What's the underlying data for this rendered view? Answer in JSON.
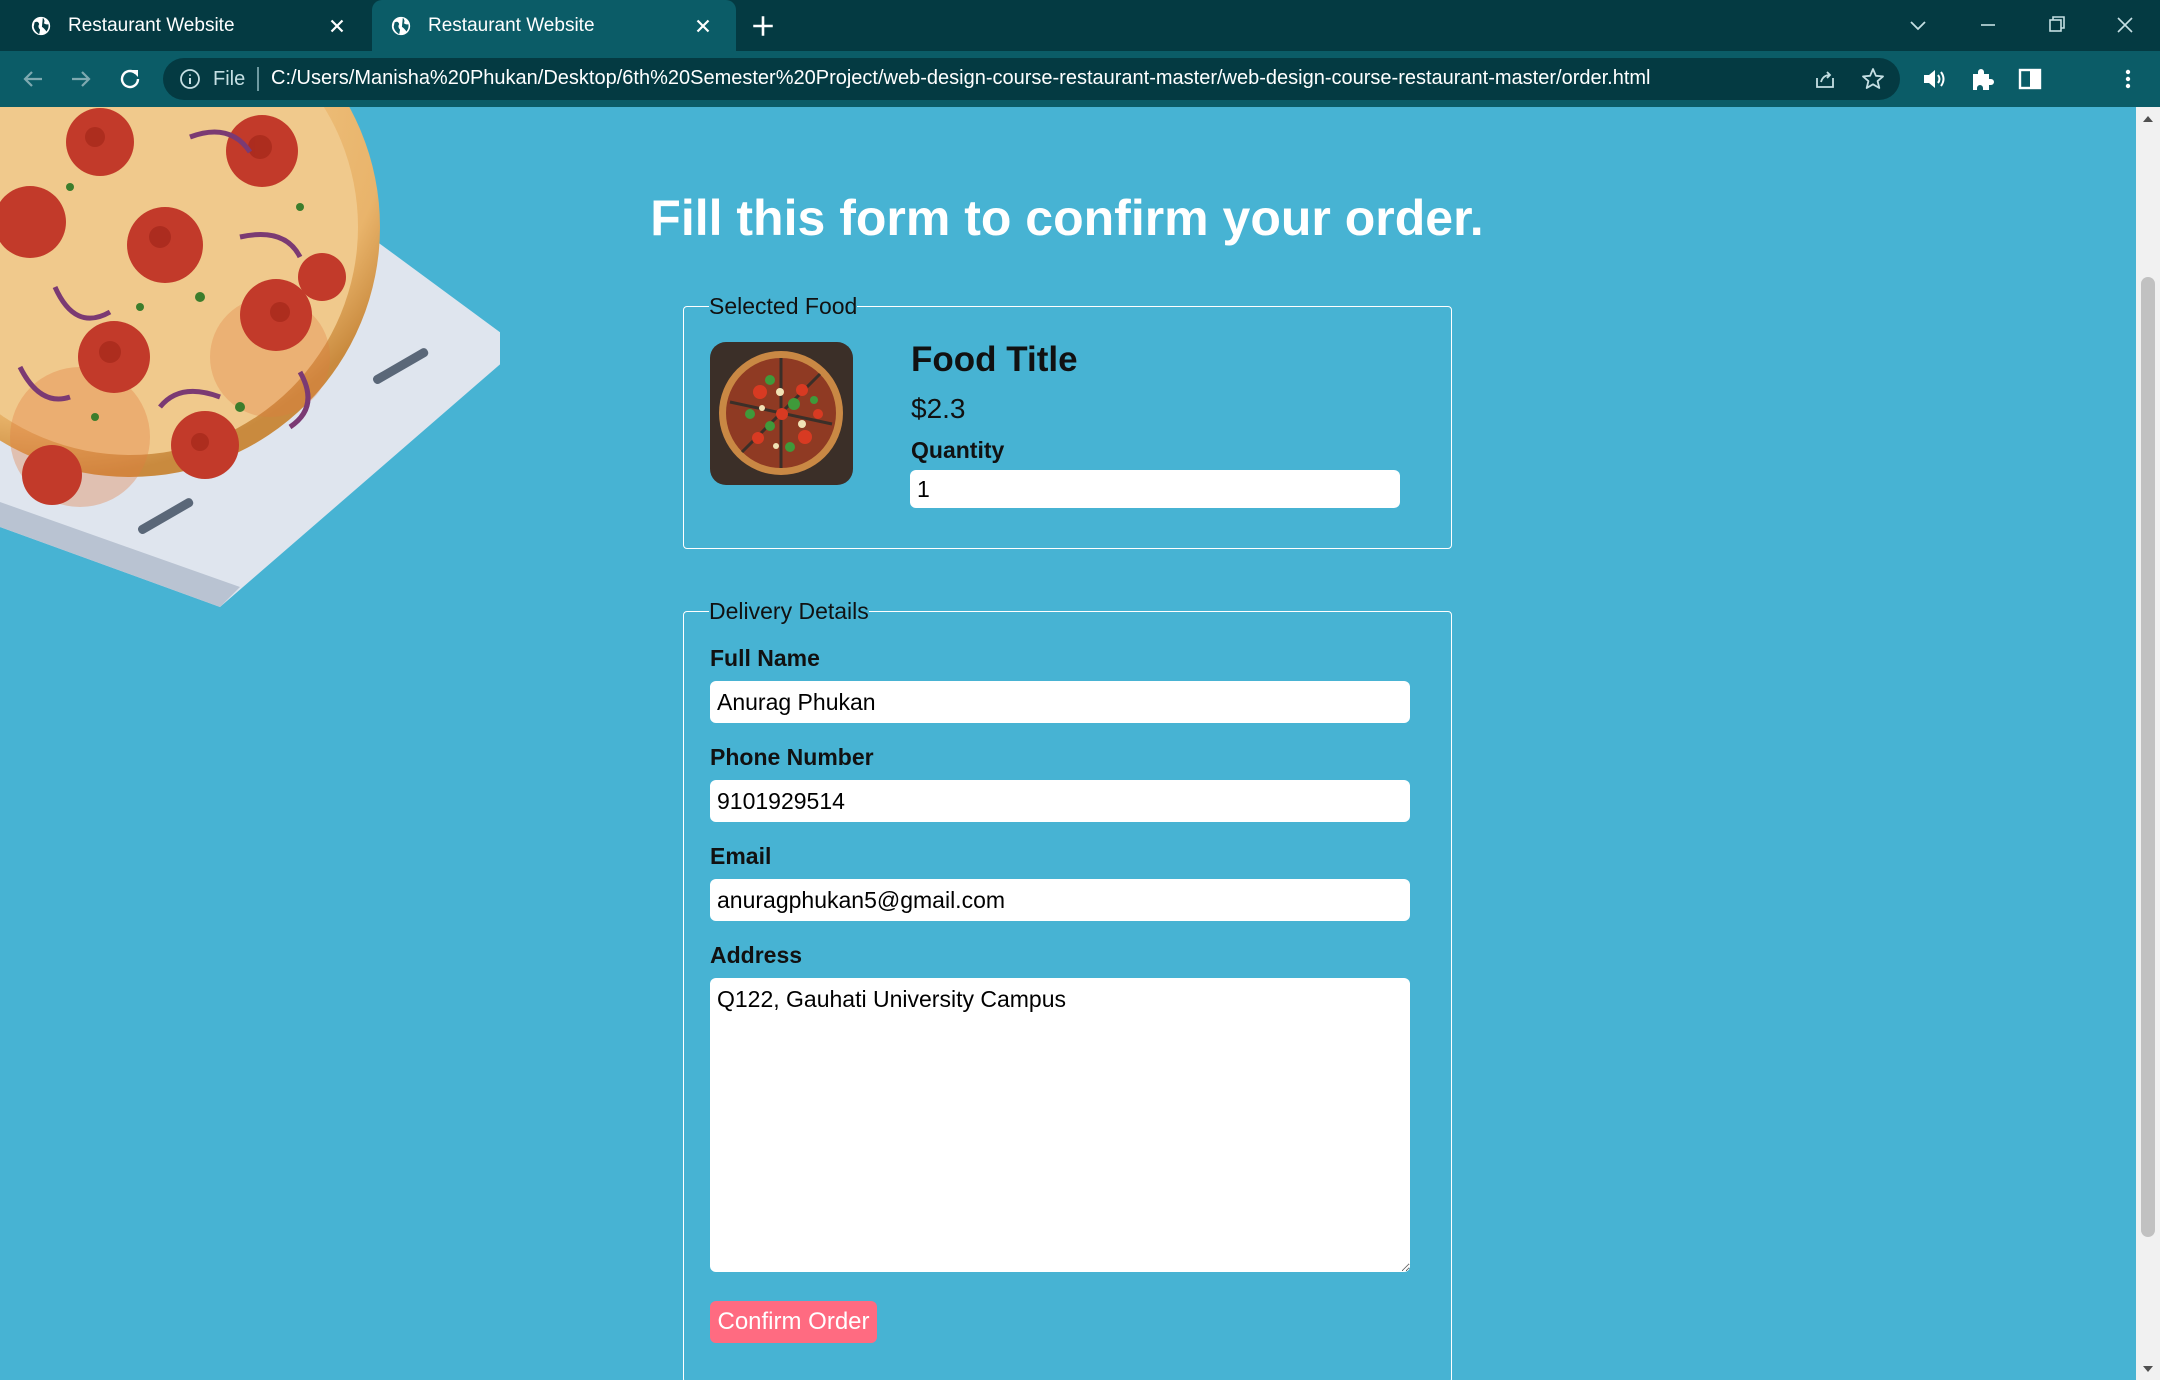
{
  "browser": {
    "tabs": [
      {
        "title": "Restaurant Website",
        "active": false
      },
      {
        "title": "Restaurant Website",
        "active": true
      }
    ],
    "omnibox": {
      "scheme_label": "File",
      "url": "C:/Users/Manisha%20Phukan/Desktop/6th%20Semester%20Project/web-design-course-restaurant-master/web-design-course-restaurant-master/order.html"
    },
    "icons": [
      "back-icon",
      "forward-icon",
      "reload-icon",
      "info-icon",
      "share-icon",
      "star-icon",
      "speaker-icon",
      "extensions-icon",
      "sidepanel-icon",
      "avatar",
      "menu-icon"
    ],
    "colors": {
      "tabbar": "#043a42",
      "toolbar": "#0b5c67",
      "page_bg": "#47b3d3",
      "accent_button": "#ff6b81"
    }
  },
  "page": {
    "heading": "Fill this form to confirm your order.",
    "selected_food": {
      "legend": "Selected Food",
      "title": "Food Title",
      "price": "$2.3",
      "quantity_label": "Quantity",
      "quantity_value": "1"
    },
    "delivery": {
      "legend": "Delivery Details",
      "full_name_label": "Full Name",
      "full_name_value": "Anurag Phukan",
      "phone_label": "Phone Number",
      "phone_value": "9101929514",
      "email_label": "Email",
      "email_value": "anuragphukan5@gmail.com",
      "address_label": "Address",
      "address_value": "Q122, Gauhati University Campus",
      "confirm_label": "Confirm Order"
    }
  }
}
